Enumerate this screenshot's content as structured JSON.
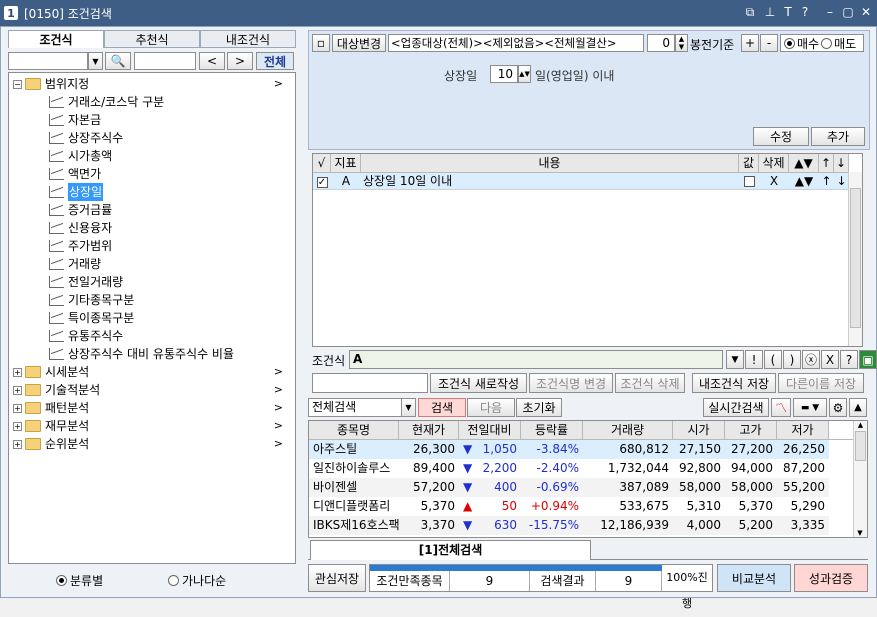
{
  "window": {
    "number": "1",
    "title": "[0150] 조건검색"
  },
  "left": {
    "tabs": [
      "조건식",
      "추천식",
      "내조건식"
    ],
    "all_button": "전체",
    "prev": "<",
    "next": ">",
    "tree": [
      {
        "label": "범위지정",
        "type": "folder",
        "expanded": true
      },
      {
        "label": "거래소/코스닥 구분",
        "type": "item"
      },
      {
        "label": "자본금",
        "type": "item"
      },
      {
        "label": "상장주식수",
        "type": "item"
      },
      {
        "label": "시가총액",
        "type": "item"
      },
      {
        "label": "액면가",
        "type": "item"
      },
      {
        "label": "상장일",
        "type": "item",
        "selected": true
      },
      {
        "label": "증거금률",
        "type": "item"
      },
      {
        "label": "신용융자",
        "type": "item"
      },
      {
        "label": "주가범위",
        "type": "item"
      },
      {
        "label": "거래량",
        "type": "item"
      },
      {
        "label": "전일거래량",
        "type": "item"
      },
      {
        "label": "기타종목구분",
        "type": "item"
      },
      {
        "label": "특이종목구분",
        "type": "item"
      },
      {
        "label": "유통주식수",
        "type": "item"
      },
      {
        "label": "상장주식수 대비 유통주식수 비율",
        "type": "item"
      },
      {
        "label": "시세분석",
        "type": "folder"
      },
      {
        "label": "기술적분석",
        "type": "folder"
      },
      {
        "label": "패턴분석",
        "type": "folder"
      },
      {
        "label": "재무분석",
        "type": "folder"
      },
      {
        "label": "순위분석",
        "type": "folder"
      }
    ],
    "radio1": "분류별",
    "radio2": "가나다순"
  },
  "top": {
    "target_btn": "대상변경",
    "target_text": "<업종대상(전체)><제외없음><전체월결산>",
    "bong_value": "0",
    "bong_label": "봉전기준",
    "plus": "+",
    "minus": "-",
    "buy": "매수",
    "sell": "매도",
    "listing_label": "상장일",
    "listing_value": "10",
    "listing_suffix": "일(영업일) 이내",
    "modify": "수정",
    "add": "추가"
  },
  "cond_table": {
    "headers": [
      "√",
      "지표",
      "내용",
      "값",
      "삭제",
      "▲▼",
      "↑",
      "↓"
    ],
    "row": {
      "check": "✓",
      "index": "A",
      "content": "상장일 10일 이내",
      "del": "X",
      "updown": "▲▼",
      "up": "↑",
      "down": "↓"
    }
  },
  "formula": {
    "label": "조건식",
    "value": "A",
    "ops": [
      "▼",
      "!",
      "(",
      ")",
      "ⓧ",
      "X",
      "?"
    ]
  },
  "actions": [
    "조건식 새로작성",
    "조건식명 변경",
    "조건식 삭제",
    "내조건식 저장",
    "다른이름 저장"
  ],
  "search": {
    "select": "전체검색",
    "search": "검색",
    "next": "다음",
    "reset": "초기화",
    "realtime": "실시간검색"
  },
  "results": {
    "headers": [
      "종목명",
      "현재가",
      "전일대비",
      "등락률",
      "거래량",
      "시가",
      "고가",
      "저가"
    ],
    "rows": [
      [
        "아주스틸",
        "26,300",
        "▼",
        "1,050",
        "-3.84%",
        "680,812",
        "27,150",
        "27,200",
        "26,250"
      ],
      [
        "일진하이솔루스",
        "89,400",
        "▼",
        "2,200",
        "-2.40%",
        "1,732,044",
        "92,800",
        "94,000",
        "87,200"
      ],
      [
        "바이젠셀",
        "57,200",
        "▼",
        "400",
        "-0.69%",
        "387,089",
        "58,000",
        "58,000",
        "55,200"
      ],
      [
        "디앤디플랫폼리",
        "5,370",
        "▲",
        "50",
        "+0.94%",
        "533,675",
        "5,310",
        "5,370",
        "5,290"
      ],
      [
        "IBKS제16호스팩",
        "3,370",
        "▼",
        "630",
        "-15.75%",
        "12,186,939",
        "4,000",
        "5,200",
        "3,335"
      ]
    ]
  },
  "bottom": {
    "tab": "[1]전체검색",
    "save": "관심저장",
    "match_label": "조건만족종목",
    "match_value": "9",
    "result_label": "검색결과",
    "result_value": "9",
    "progress": "100%진행",
    "compare": "비교분석",
    "perf": "성과검증"
  },
  "colors": {
    "title": "#3f5e86",
    "selected": "#3399ff",
    "up": "#e00000",
    "down": "#1f2fd0"
  }
}
